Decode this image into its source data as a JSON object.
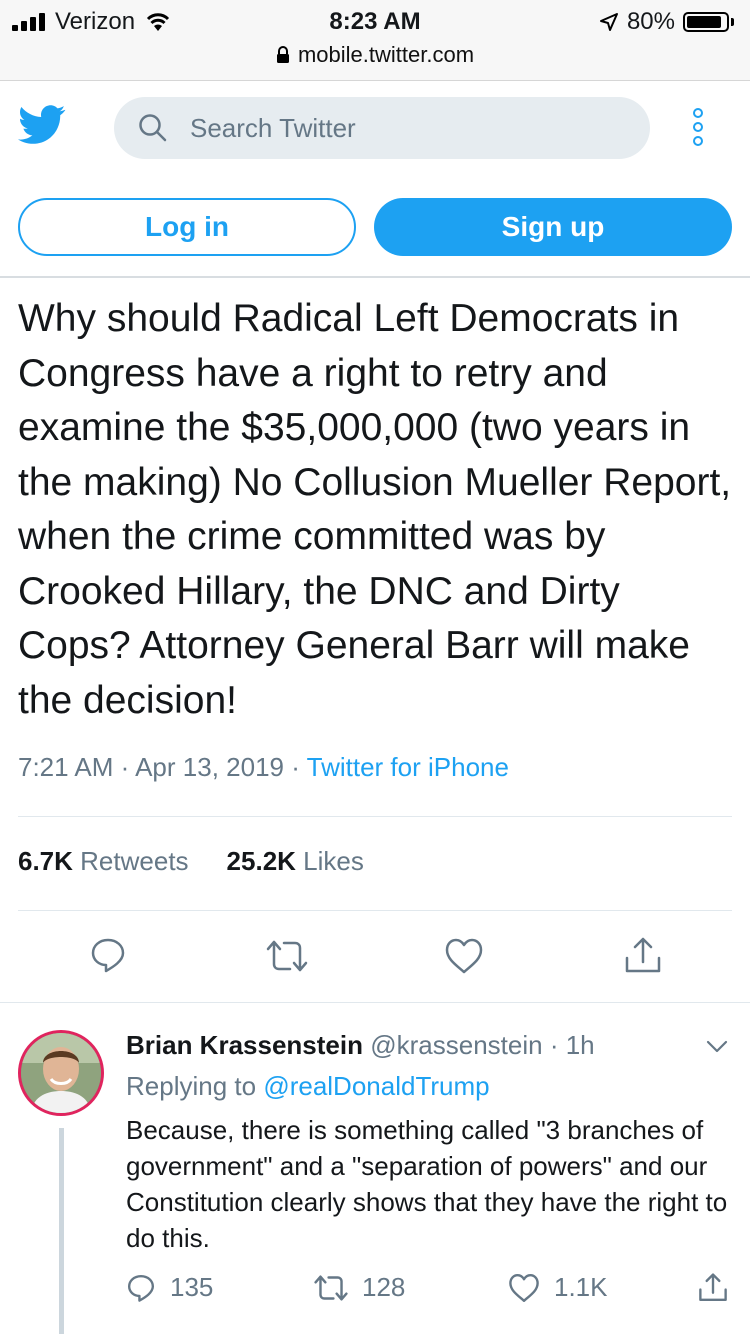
{
  "status_bar": {
    "carrier": "Verizon",
    "time": "8:23 AM",
    "battery": "80%",
    "url": "mobile.twitter.com"
  },
  "header": {
    "search_placeholder": "Search Twitter",
    "login_label": "Log in",
    "signup_label": "Sign up"
  },
  "tweet": {
    "text": "Why should Radical Left Democrats in Congress have a right to retry and examine the $35,000,000 (two years in the making) No Collusion Mueller Report, when the crime committed was by Crooked Hillary, the DNC and Dirty Cops? Attorney General Barr will make the decision!",
    "time": "7:21 AM",
    "date": "Apr 13, 2019",
    "source": "Twitter for iPhone",
    "retweets_count": "6.7K",
    "retweets_label": "Retweets",
    "likes_count": "25.2K",
    "likes_label": "Likes"
  },
  "reply": {
    "name": "Brian Krassenstein",
    "handle": "@krassenstein",
    "age": "1h",
    "replying_to_label": "Replying to",
    "replying_to": "@realDonaldTrump",
    "text": "Because, there is something called \"3 branches of government\" and a \"separation of powers\" and our Constitution clearly shows that they have the right to do this.",
    "replies": "135",
    "retweets": "128",
    "likes": "1.1K"
  },
  "colors": {
    "accent": "#1da1f2",
    "muted": "#657786",
    "text": "#14171a"
  }
}
